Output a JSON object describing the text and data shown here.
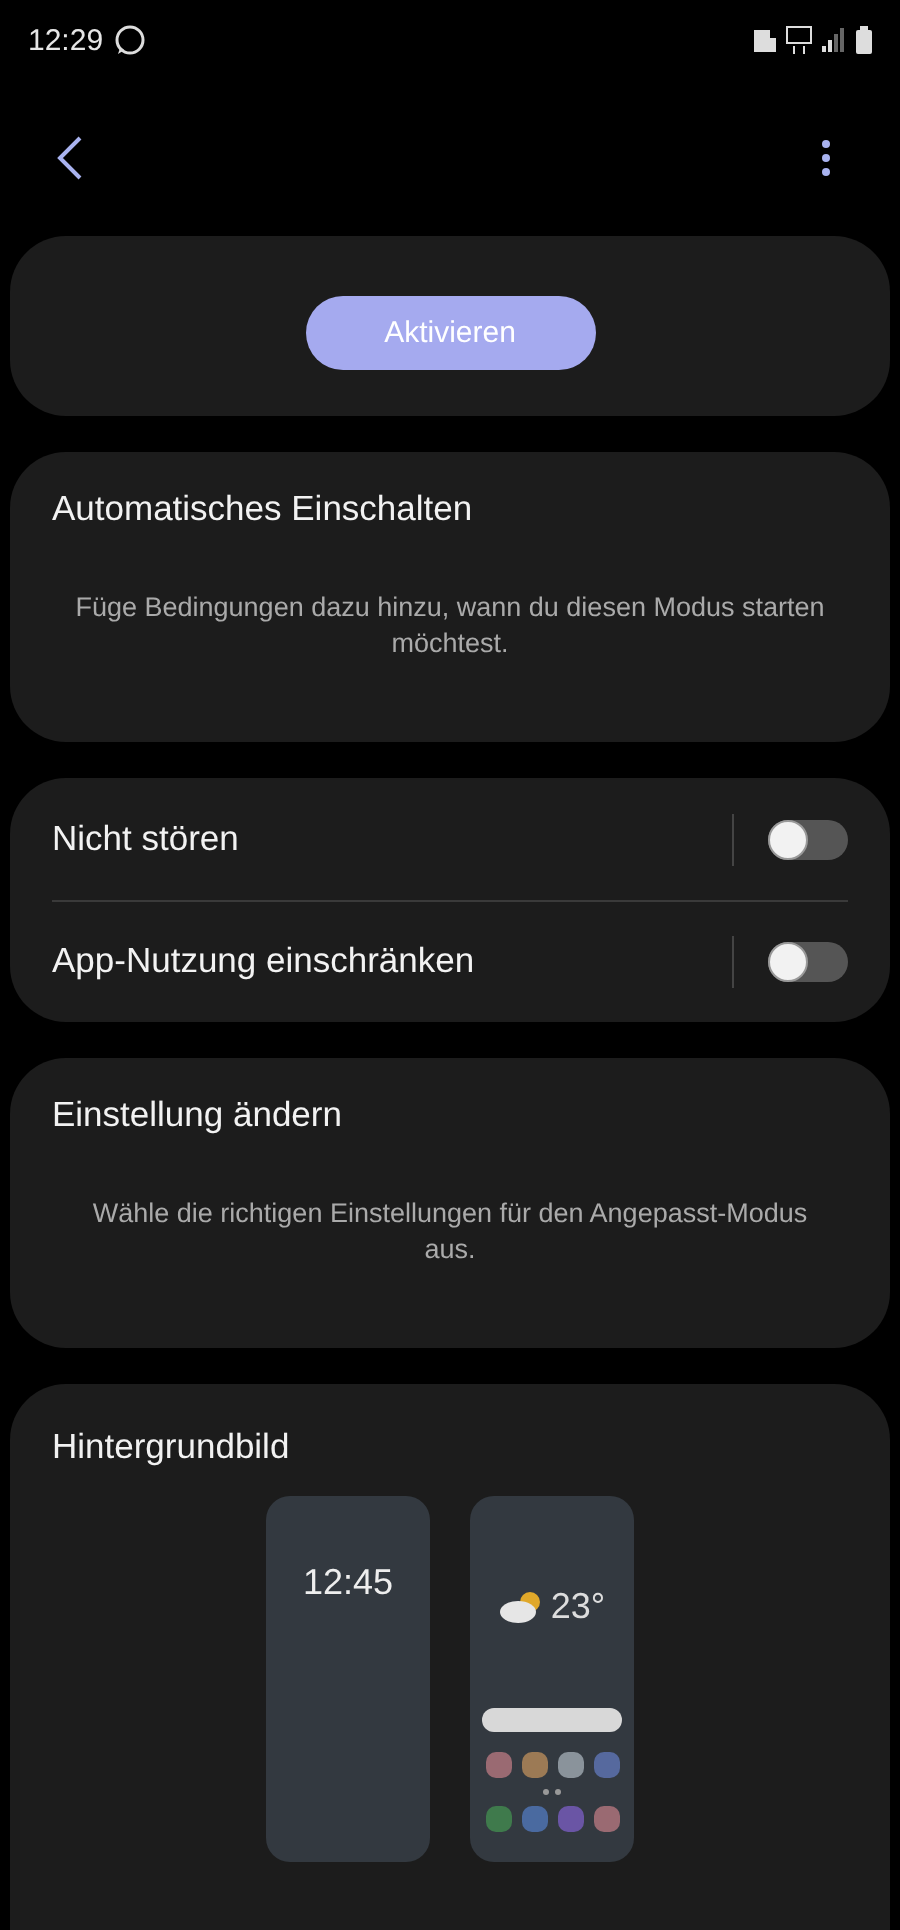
{
  "status_bar": {
    "time": "12:29"
  },
  "activate_card": {
    "button": "Aktivieren"
  },
  "auto_card": {
    "title": "Automatisches Einschalten",
    "description": "Füge Bedingungen dazu hinzu, wann du diesen Modus starten möchtest."
  },
  "toggles": [
    {
      "label": "Nicht stören",
      "on": false
    },
    {
      "label": "App-Nutzung einschränken",
      "on": false
    }
  ],
  "settings_card": {
    "title": "Einstellung ändern",
    "description": "Wähle die richtigen Einstellungen für den Angepasst-Modus aus."
  },
  "wallpaper_card": {
    "title": "Hintergrundbild",
    "lock_screen_time": "12:45",
    "home_screen_temperature": "23°"
  }
}
